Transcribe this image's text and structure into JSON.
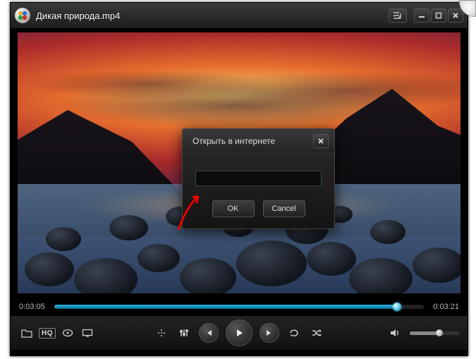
{
  "titlebar": {
    "filename": "Дикая природа.mp4"
  },
  "playback": {
    "current_time": "0:03:05",
    "total_time": "0:03:21",
    "hq_label": "HQ"
  },
  "dialog": {
    "title": "Открыть в интернете",
    "url_value": "",
    "ok_label": "OK",
    "cancel_label": "Cancel"
  }
}
